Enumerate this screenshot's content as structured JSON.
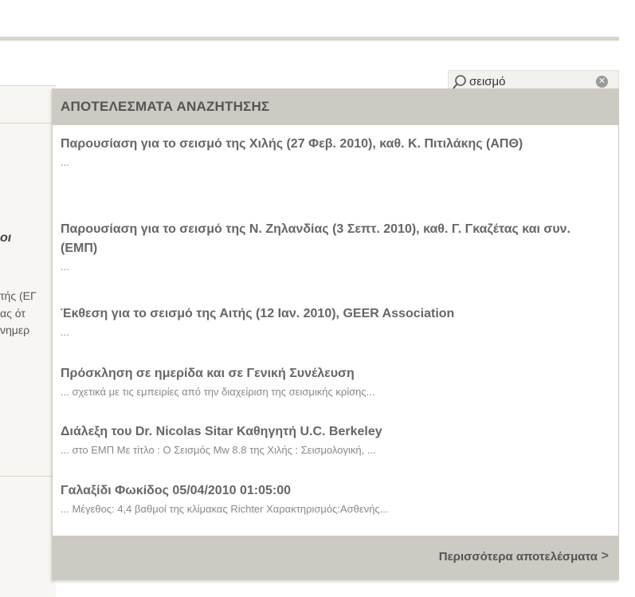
{
  "background": {
    "partial_heading": "oι",
    "partial_lines": [
      "τής (ΕΓ",
      "ας ότ",
      "νημερ"
    ]
  },
  "search": {
    "value": "σεισμό",
    "clear_icon": "clear-circle-icon"
  },
  "results": {
    "header": "ΑΠΟΤΕΛΕΣΜΑΤΑ ΑΝΑΖΗΤΗΣΗΣ",
    "items": [
      {
        "title": "Παρουσίαση για το σεισμό της Χιλής (27 Φεβ. 2010), καθ. Κ. Πιτιλάκης (ΑΠΘ)",
        "snippet": "..."
      },
      {
        "title": "Παρουσίαση για το σεισμό της Ν. Ζηλανδίας (3 Σεπτ. 2010), καθ. Γ. Γκαζέτας και συν. (ΕΜΠ)",
        "snippet": "..."
      },
      {
        "title": "Έκθεση για το σεισμό της Αιτής (12 Ιαν. 2010), GEER Association",
        "snippet": "..."
      },
      {
        "title": "Πρόσκληση σε ημερίδα και σε Γενική Συνέλευση",
        "snippet": "... σχετικά με τις εμπειρίες από την διαχείριση της σεισμικής κρίσης..."
      },
      {
        "title": "Διάλεξη του Dr. Nicolas Sitar Καθηγητή U.C. Berkeley",
        "snippet": "... στο ΕΜΠ Με τίτλο :     Ο Σεισμός Mw 8.8 της Χιλής : Σεισμολογική, ..."
      },
      {
        "title": "Γαλαξίδι Φωκίδος 05/04/2010 01:05:00",
        "snippet": "... Μέγεθος: 4,4 βαθμοί της κλίμακας Richter Χαρακτηρισμός:Ασθενής..."
      }
    ],
    "more_label": "Περισσότερα αποτελέσματα",
    "more_chevron": ">"
  },
  "colors": {
    "header_bg": "#cdcac3",
    "title_text": "#666666",
    "snippet_text": "#888888"
  }
}
